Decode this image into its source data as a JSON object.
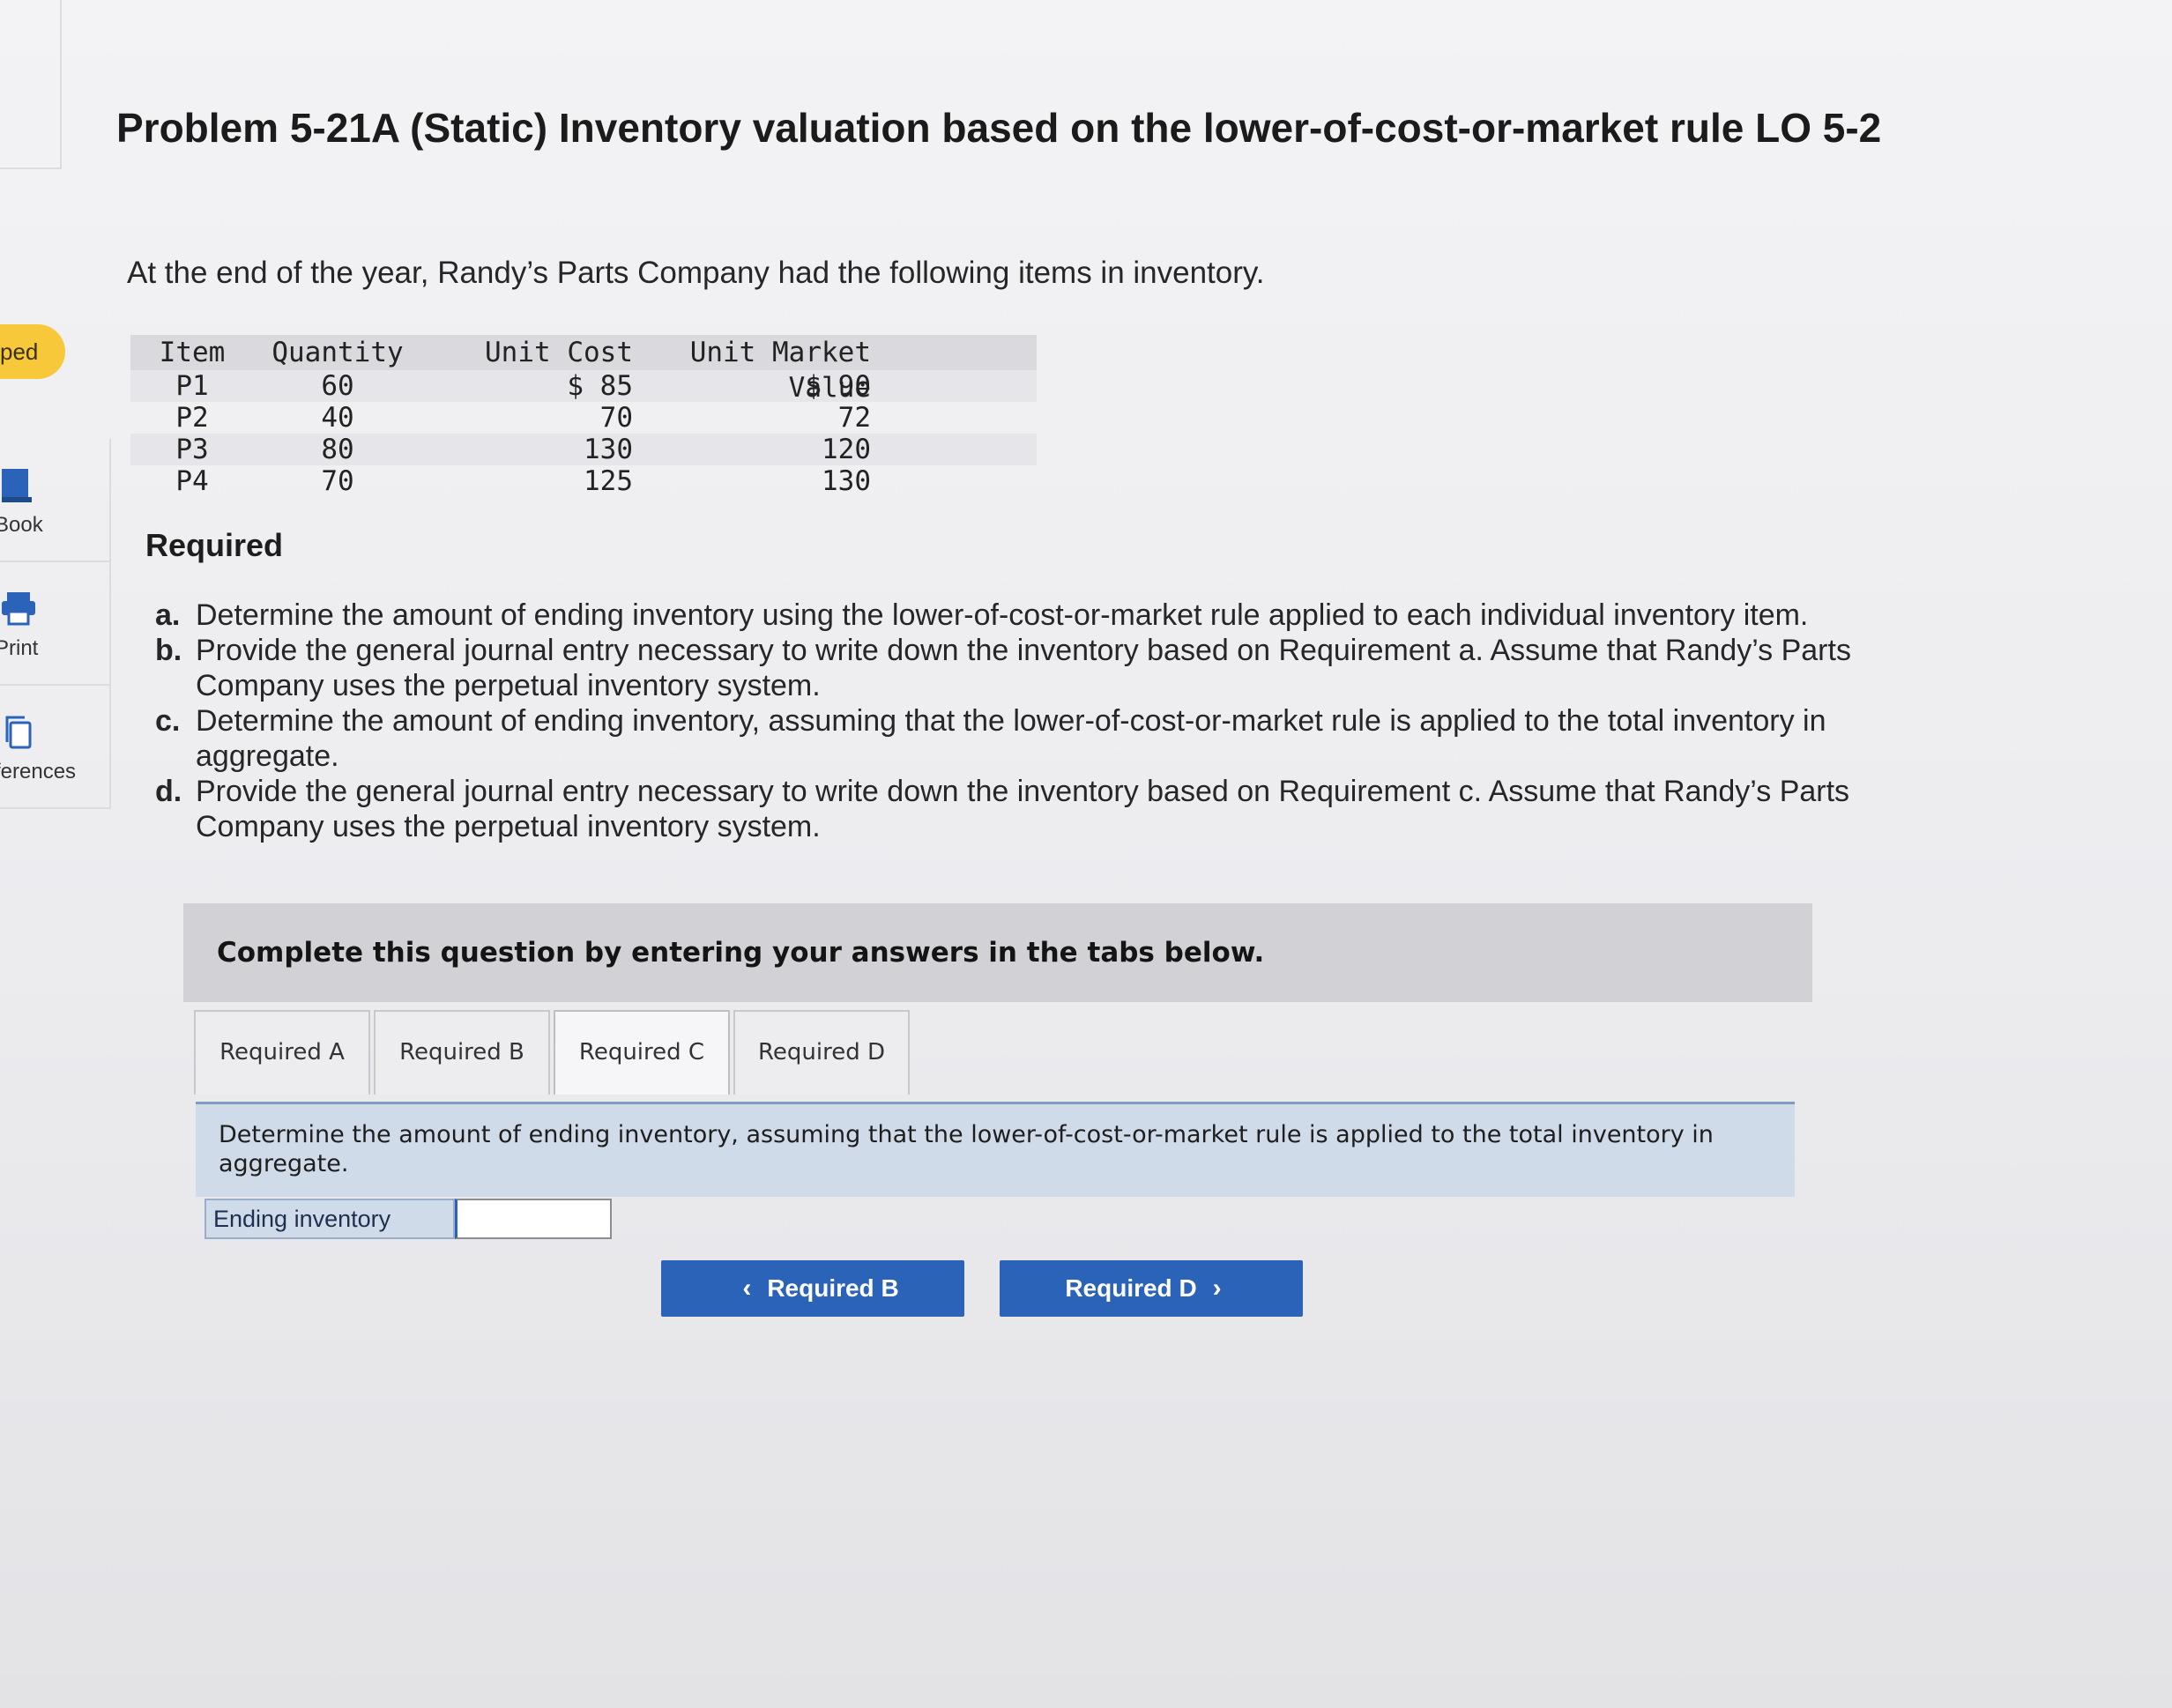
{
  "sidebar": {
    "badge": "ped",
    "items": [
      {
        "label": "Book"
      },
      {
        "label": "Print"
      },
      {
        "label": "ferences"
      }
    ]
  },
  "problem": {
    "title": "Problem 5-21A (Static) Inventory valuation based on the lower-of-cost-or-market rule LO 5-2",
    "intro": "At the end of the year, Randy’s Parts Company had the following items in inventory."
  },
  "inventory_table": {
    "headers": [
      "Item",
      "Quantity",
      "Unit Cost",
      "Unit Market Value"
    ],
    "rows": [
      [
        "P1",
        "60",
        "$ 85",
        "$ 90"
      ],
      [
        "P2",
        "40",
        "70",
        "72"
      ],
      [
        "P3",
        "80",
        "130",
        "120"
      ],
      [
        "P4",
        "70",
        "125",
        "130"
      ]
    ]
  },
  "required": {
    "heading": "Required",
    "items": [
      {
        "letter": "a.",
        "text": "Determine the amount of ending inventory using the lower-of-cost-or-market rule applied to each individual inventory item."
      },
      {
        "letter": "b.",
        "text": "Provide the general journal entry necessary to write down the inventory based on Requirement a. Assume that Randy’s Parts Company uses the perpetual inventory system."
      },
      {
        "letter": "c.",
        "text": "Determine the amount of ending inventory, assuming that the lower-of-cost-or-market rule is applied to the total inventory in aggregate."
      },
      {
        "letter": "d.",
        "text": "Provide the general journal entry necessary to write down the inventory based on Requirement c. Assume that Randy’s Parts Company uses the perpetual inventory system."
      }
    ]
  },
  "banner": "Complete this question by entering your answers in the tabs below.",
  "tabs": [
    {
      "label": "Required A"
    },
    {
      "label": "Required B"
    },
    {
      "label": "Required C",
      "active": true
    },
    {
      "label": "Required D"
    }
  ],
  "tab_description": "Determine the amount of ending inventory, assuming that the lower-of-cost-or-market rule is applied to the total inventory in aggregate.",
  "answer": {
    "label": "Ending inventory",
    "value": ""
  },
  "nav": {
    "prev_label": "Required B",
    "next_label": "Required D"
  },
  "colors": {
    "accent": "#2b63b8",
    "badge": "#f7c93a",
    "tab_panel": "#cfdbe8"
  }
}
